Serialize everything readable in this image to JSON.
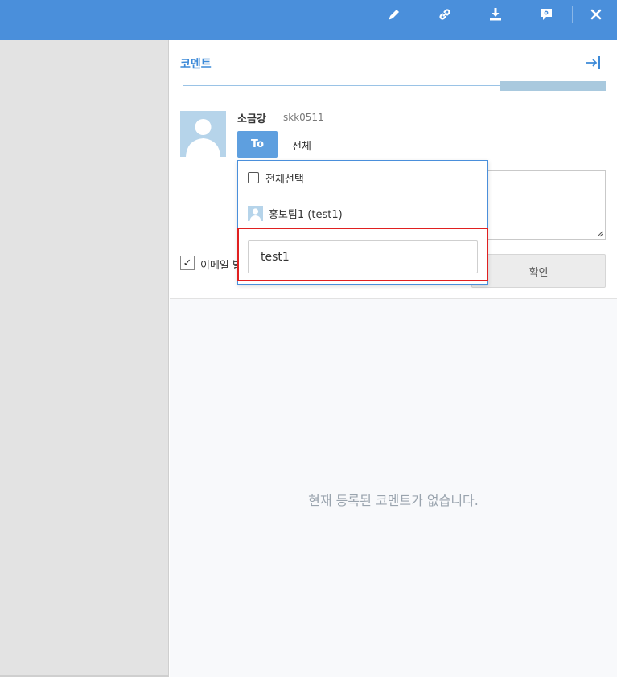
{
  "toolbar": {
    "icons": [
      "pencil-icon",
      "link-icon",
      "download-icon",
      "comment-icon",
      "close-icon"
    ]
  },
  "panel": {
    "title": "코멘트",
    "collapse_icon": "collapse-right-icon"
  },
  "user": {
    "name": "소금강",
    "id": "skk0511"
  },
  "recipient": {
    "to_label": "To",
    "value": "전체"
  },
  "dropdown": {
    "select_all_label": "전체선택",
    "items": [
      {
        "label": "홍보팀1 (test1)"
      }
    ],
    "search_value": "test1"
  },
  "email_option": {
    "label": "이메일 발송",
    "checked": true
  },
  "confirm_label": "확인",
  "empty_message": "현재 등록된 코멘트가 없습니다.",
  "colors": {
    "topbar": "#4a8fdb",
    "accent": "#3d8ad8",
    "highlight": "#e02020"
  }
}
